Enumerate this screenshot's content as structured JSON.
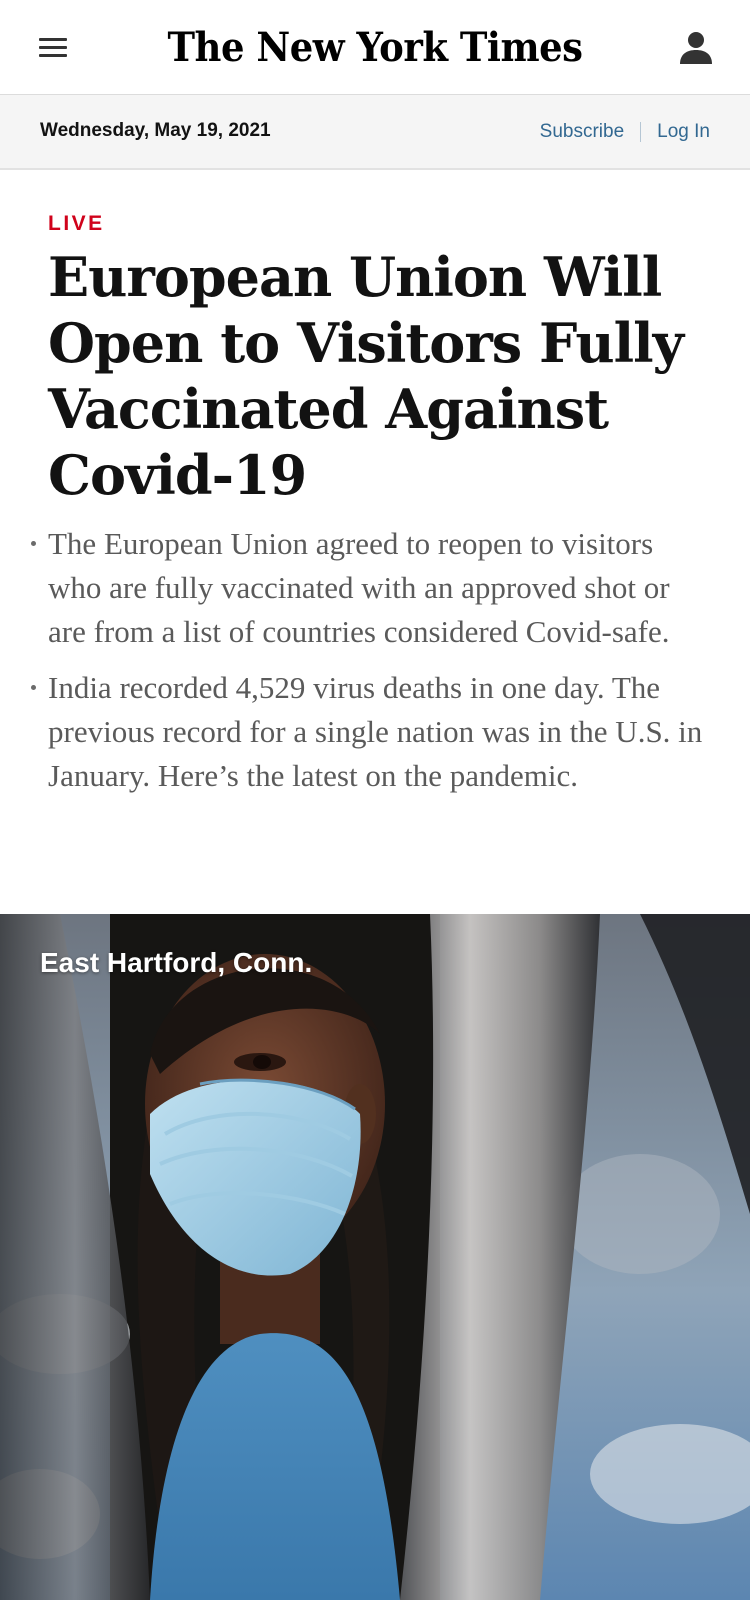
{
  "masthead": {
    "logo_text": "The New York Times",
    "menu_icon": "hamburger-menu-icon",
    "account_icon": "user-account-icon"
  },
  "datebar": {
    "date": "Wednesday, May 19, 2021",
    "subscribe_label": "Subscribe",
    "login_label": "Log In"
  },
  "article": {
    "label": "LIVE",
    "headline": "European Union Will Open to Visitors Fully Vaccinated Against Covid-19",
    "summary": [
      "The European Union agreed to reopen to visitors who are fully vaccinated with an approved shot or are from a list of countries considered Covid-safe.",
      "India recorded 4,529 virus deaths in one day. The previous record for a single nation was in the U.S. in January. Here’s the latest on the pandemic."
    ]
  },
  "photo": {
    "caption": "East Hartford, Conn."
  },
  "colors": {
    "live_red": "#d0021b",
    "link_blue": "#326891",
    "summary_gray": "#5a5a5a",
    "datebar_bg": "#f5f5f5"
  }
}
